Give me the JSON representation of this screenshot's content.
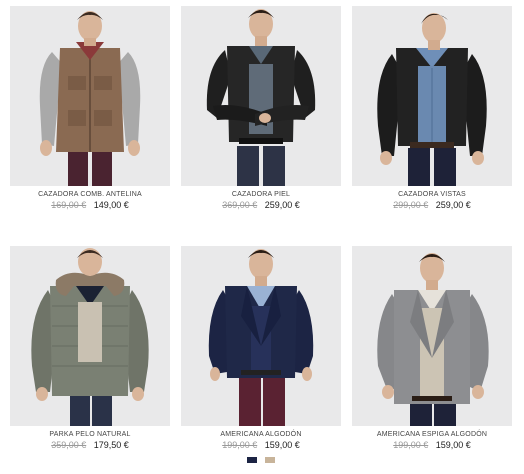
{
  "currency": "€",
  "products": [
    {
      "name": "CAZADORA COMB. ANTELINA",
      "old_price": "169,00 €",
      "price": "149,00 €",
      "image": "man-in-suede-vest-knit-sleeves-jacket"
    },
    {
      "name": "CAZADORA PIEL",
      "old_price": "369,00 €",
      "price": "259,00 €",
      "image": "man-in-black-leather-jacket"
    },
    {
      "name": "CAZADORA VISTAS",
      "old_price": "299,00 €",
      "price": "259,00 €",
      "image": "man-in-black-leather-jacket-denim-shirt"
    },
    {
      "name": "PARKA PELO NATURAL",
      "old_price": "359,00 €",
      "price": "179,50 €",
      "image": "man-in-grey-parka-fur-hood"
    },
    {
      "name": "AMERICANA ALGODÓN",
      "old_price": "199,00 €",
      "price": "159,00 €",
      "image": "man-in-navy-blazer-burgundy-trousers",
      "swatches": [
        "#1c2444",
        "#c8b49a"
      ]
    },
    {
      "name": "AMERICANA ESPIGA ALGODÓN",
      "old_price": "199,00 €",
      "price": "159,00 €",
      "image": "man-in-grey-herringbone-blazer"
    }
  ]
}
